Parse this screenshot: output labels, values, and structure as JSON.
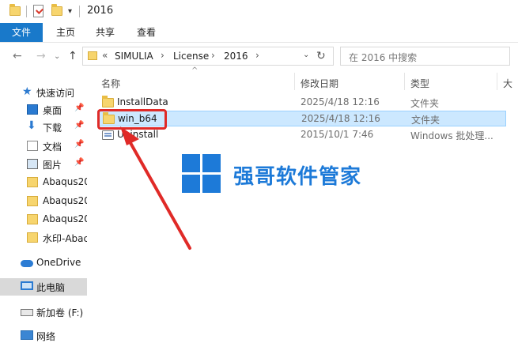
{
  "window": {
    "title": "2016"
  },
  "ribbon": {
    "tabs": [
      "文件",
      "主页",
      "共享",
      "查看"
    ]
  },
  "address": {
    "crumbs": [
      "SIMULIA",
      "License",
      "2016"
    ],
    "search_placeholder": "在 2016 中搜索"
  },
  "sidebar": {
    "items": [
      {
        "label": "快速访问",
        "icon": "star-icon"
      },
      {
        "label": "桌面",
        "icon": "desktop-icon",
        "pinned": true
      },
      {
        "label": "下载",
        "icon": "download-icon",
        "pinned": true
      },
      {
        "label": "文档",
        "icon": "document-icon",
        "pinned": true
      },
      {
        "label": "图片",
        "icon": "picture-icon",
        "pinned": true
      },
      {
        "label": "Abaqus20",
        "icon": "folder-icon"
      },
      {
        "label": "Abaqus20",
        "icon": "folder-icon"
      },
      {
        "label": "Abaqus20",
        "icon": "folder-icon"
      },
      {
        "label": "水印-Abac",
        "icon": "folder-icon"
      },
      {
        "label": "OneDrive",
        "icon": "onedrive-icon"
      },
      {
        "label": "此电脑",
        "icon": "pc-icon",
        "selected": true
      },
      {
        "label": "新加卷 (F:)",
        "icon": "drive-icon"
      },
      {
        "label": "网络",
        "icon": "network-icon"
      }
    ]
  },
  "columns": {
    "name": "名称",
    "date": "修改日期",
    "type": "类型",
    "size": "大"
  },
  "files": [
    {
      "name": "InstallData",
      "date": "2025/4/18 12:16",
      "type": "文件夹",
      "kind": "folder"
    },
    {
      "name": "win_b64",
      "date": "2025/4/18 12:16",
      "type": "文件夹",
      "kind": "folder",
      "selected": true
    },
    {
      "name": "Uninstall",
      "date": "2015/10/1 7:46",
      "type": "Windows 批处理...",
      "kind": "batch"
    }
  ],
  "watermark": {
    "text": "强哥软件管家"
  },
  "colors": {
    "accent": "#1979ca",
    "highlight": "#e02a27",
    "selection": "#cce8ff"
  }
}
